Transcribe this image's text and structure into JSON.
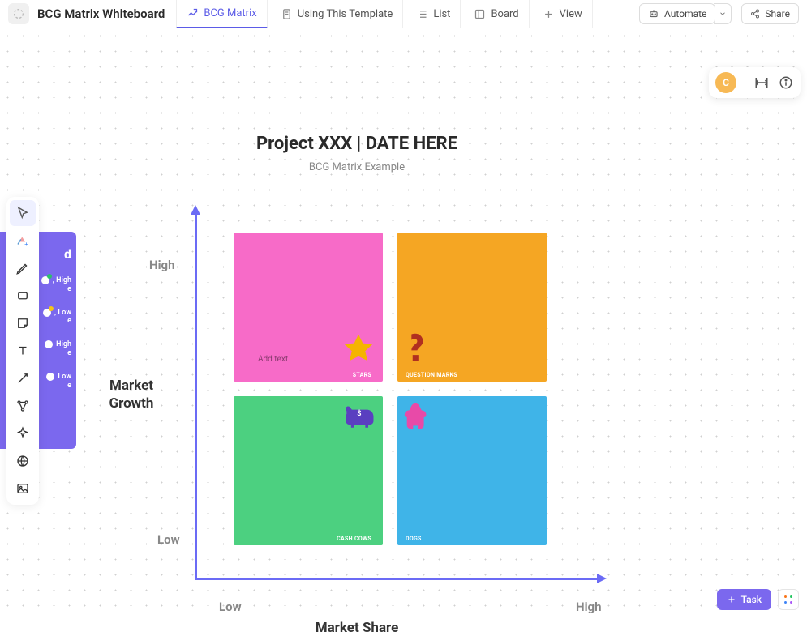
{
  "header": {
    "title": "BCG Matrix Whiteboard",
    "tabs": [
      {
        "label": "BCG Matrix",
        "active": true
      },
      {
        "label": "Using This Template"
      },
      {
        "label": "List"
      },
      {
        "label": "Board"
      },
      {
        "label": "View"
      }
    ],
    "automate": "Automate",
    "share": "Share"
  },
  "user": {
    "avatar_letter": "C"
  },
  "toolbar_icons": [
    "cursor",
    "shapes-plus",
    "pen",
    "rectangle",
    "note",
    "text",
    "connector",
    "relationship",
    "ai",
    "globe",
    "image"
  ],
  "diagram": {
    "title": "Project XXX | DATE HERE",
    "subtitle": "BCG Matrix Example",
    "y_axis": {
      "label": "Market Growth",
      "high": "High",
      "low": "Low"
    },
    "x_axis": {
      "label": "Market Share",
      "low": "Low",
      "high": "High"
    },
    "quadrants": {
      "top_left": {
        "name": "STARS",
        "color": "#f76bc8",
        "icon": "star",
        "placeholder": "Add text"
      },
      "top_right": {
        "name": "QUESTION MARKS",
        "color": "#f5a623",
        "icon": "question"
      },
      "bottom_left": {
        "name": "CASH COWS",
        "color": "#4cd080",
        "icon": "cow"
      },
      "bottom_right": {
        "name": "DOGS",
        "color": "#3fb4e8",
        "icon": "dog"
      }
    }
  },
  "legend": {
    "title_fragment": "d",
    "items": [
      {
        "text_fragment": ", High\ne",
        "dot": "#fff",
        "accent": "#2bbf6a"
      },
      {
        "text_fragment": ", Low\ne",
        "dot": "#fff",
        "accent": "#f5c518"
      },
      {
        "text_fragment": "High\ne",
        "dot": "#fff",
        "accent": ""
      },
      {
        "text_fragment": "Low\ne",
        "dot": "#fff",
        "accent": ""
      }
    ]
  },
  "footer": {
    "task_button": "Task"
  }
}
